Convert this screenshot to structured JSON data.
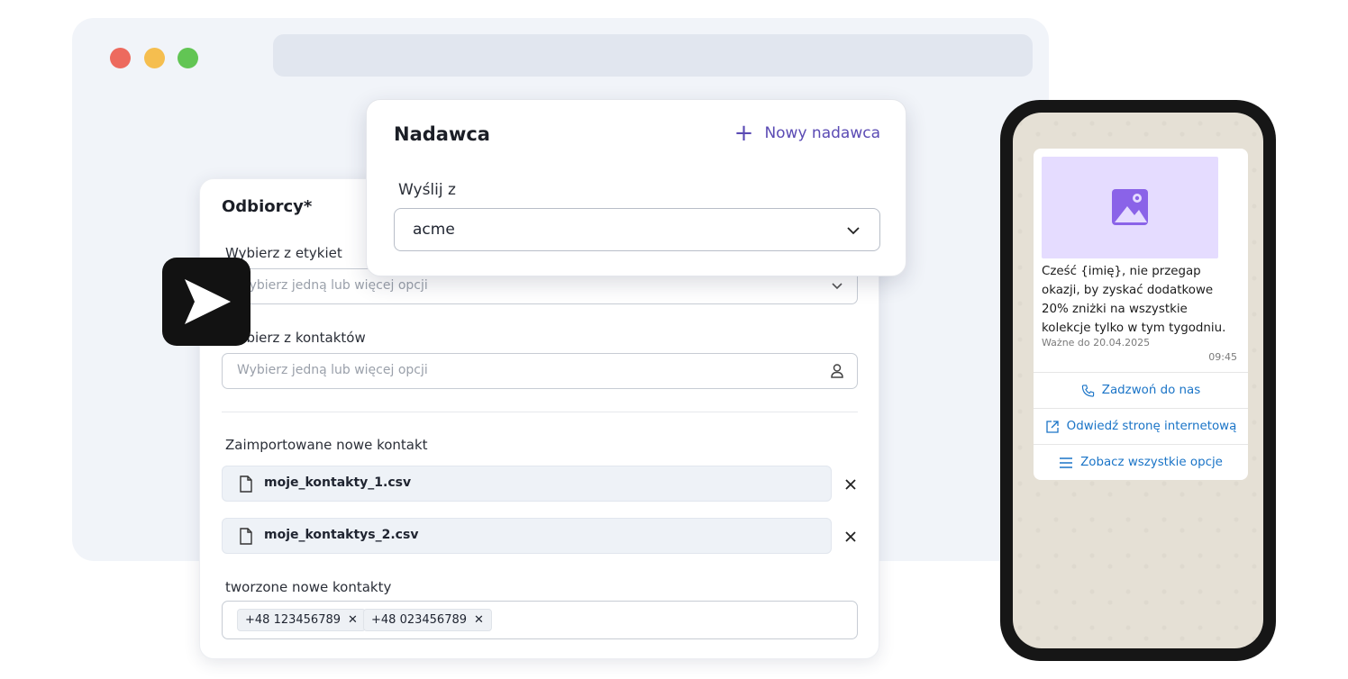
{
  "recipients": {
    "title": "Odbiorcy*",
    "tags_label": "Wybierz z etykiet",
    "tags_placeholder": "Wybierz jedną lub więcej opcji",
    "contacts_label": "Wybierz z kontaktów",
    "contacts_placeholder": "Wybierz jedną lub więcej opcji",
    "imported_label": "Zaimportowane nowe kontakt",
    "files": [
      {
        "name": "moje_kontakty_1.csv"
      },
      {
        "name": "moje_kontaktys_2.csv"
      }
    ],
    "created_label": "tworzone nowe kontakty",
    "chips": [
      "+48 123456789",
      "+48 023456789"
    ]
  },
  "sender": {
    "title": "Nadawca",
    "new_sender": "Nowy nadawca",
    "send_from_label": "Wyślij z",
    "selected": "acme"
  },
  "message": {
    "text": "Cześć {imię}, nie przegap okazji, by zyskać dodatkowe 20% zniżki na wszystkie kolekcje tylko w tym tygodniu.",
    "valid": "Ważne do 20.04.2025",
    "time": "09:45",
    "actions": [
      "Zadzwoń do nas",
      "Odwiedź stronę internetową",
      "Zobacz wszystkie opcje"
    ]
  },
  "colors": {
    "accent": "#5b4bb4",
    "link": "#1a74c7",
    "image_placeholder": "#e5dcff",
    "red_dot": "#ed6a5e",
    "yellow_dot": "#f5be4f",
    "green_dot": "#62c554"
  },
  "icons": [
    "send-icon",
    "chevron-down-icon",
    "user-icon",
    "file-icon",
    "close-icon",
    "plus-icon",
    "image-icon",
    "phone-icon",
    "external-link-icon",
    "menu-icon"
  ]
}
